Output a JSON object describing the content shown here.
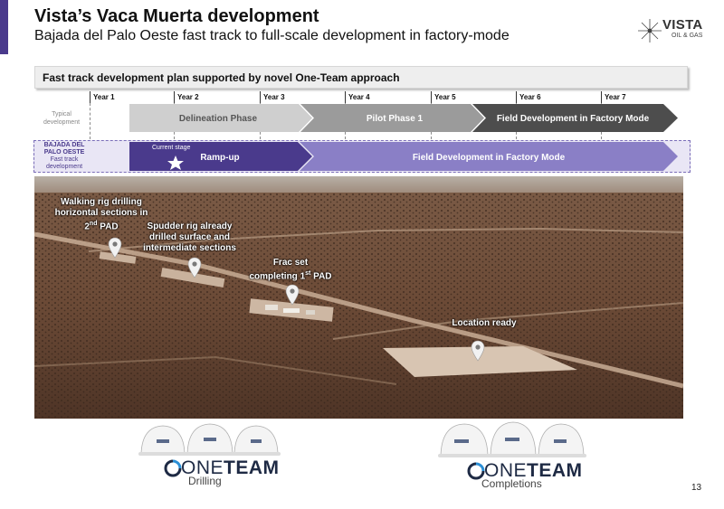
{
  "header": {
    "title": "Vista’s Vaca Muerta development",
    "subtitle": "Bajada del Palo Oeste fast track to full-scale development in factory-mode"
  },
  "logo": {
    "name": "VISTA",
    "sub": "OIL & GAS",
    "icon": "star-icon"
  },
  "banner": {
    "text": "Fast track development plan supported by novel One-Team approach"
  },
  "timeline": {
    "years": [
      "Year 1",
      "Year 2",
      "Year 3",
      "Year 4",
      "Year 5",
      "Year 6",
      "Year 7"
    ],
    "typical": {
      "label": "Typical development",
      "phases": [
        "Delineation Phase",
        "Pilot Phase 1",
        "Field Development in Factory Mode"
      ]
    },
    "bpo": {
      "label_lines": [
        "BAJADA DEL",
        "PALO OESTE",
        "Fast track",
        "development"
      ],
      "current_stage": "Current stage",
      "phases": [
        "Ramp-up",
        "Field Development in Factory Mode"
      ]
    }
  },
  "photo_callouts": {
    "walking_rig": {
      "line1": "Walking rig drilling",
      "line2": "horizontal sections in",
      "line3_pre": "2",
      "line3_sup": "nd",
      "line3_post": " PAD"
    },
    "spudder_rig": {
      "line1": "Spudder rig already",
      "line2": "drilled surface and",
      "line3": "intermediate sections"
    },
    "frac_set": {
      "line1": "Frac set",
      "line2_pre": "completing 1",
      "line2_sup": "st",
      "line2_post": " PAD"
    },
    "location": {
      "line1": "Location ready"
    }
  },
  "teams": [
    {
      "brand_one": "ONE",
      "brand_team": "TEAM",
      "caption": "Drilling"
    },
    {
      "brand_one": "ONE",
      "brand_team": "TEAM",
      "caption": "Completions"
    }
  ],
  "page_number": "13",
  "colors": {
    "accent_purple": "#4a3a8c",
    "light_purple": "#8a7fc6",
    "phase_light_gray": "#cfcfcf",
    "phase_mid_gray": "#9b9b9b",
    "phase_dark_gray": "#4d4d4d"
  }
}
